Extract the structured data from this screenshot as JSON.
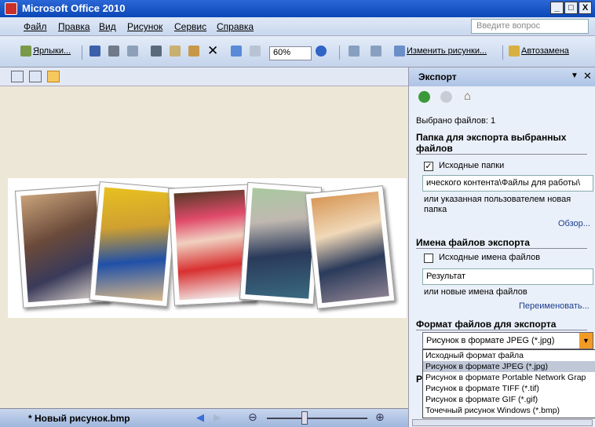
{
  "window": {
    "title": "Microsoft Office 2010",
    "controls": [
      "_",
      "□",
      "X"
    ]
  },
  "menu": {
    "items": [
      "Файл",
      "Правка",
      "Вид",
      "Рисунок",
      "Сервис",
      "Справка"
    ],
    "search_placeholder": "Введите вопрос"
  },
  "toolbar": {
    "shortcuts_label": "Ярлыки...",
    "zoom": "60%",
    "edit_pictures_label": "Изменить рисунки...",
    "autocorrect_label": "Автозамена"
  },
  "status": {
    "filename": "* Новый рисунок.bmp"
  },
  "pane": {
    "title": "Экспорт",
    "selected_files": "Выбрано файлов: 1",
    "folder_section": "Папка для экспорта выбранных файлов",
    "source_folders_label": "Исходные папки",
    "source_folders_checked": true,
    "folder_path": "ического контента\\Файлы для работы\\",
    "folder_hint": "или указанная пользователем новая папка",
    "browse": "Обзор...",
    "names_section": "Имена файлов экспорта",
    "original_names_label": "Исходные имена файлов",
    "original_names_checked": false,
    "name_value": "Результат",
    "name_hint": "или новые имена файлов",
    "rename": "Переименовать...",
    "format_section": "Формат файлов для экспорта",
    "format_selected": "Рисунок в формате JPEG (*.jpg)",
    "format_options": [
      "Исходный формат файла",
      "Рисунок в формате JPEG (*.jpg)",
      "Рисунок в формате Portable Network Grap",
      "Рисунок в формате TIFF (*.tif)",
      "Рисунок в формате GIF (*.gif)",
      "Точечный рисунок Windows (*.bmp)"
    ],
    "hidden_section_initial": "Р"
  },
  "colors": {
    "title_bar": "#0b47b6",
    "canvas": "#ede7d7",
    "dropdown_arrow": "#f29b24"
  }
}
